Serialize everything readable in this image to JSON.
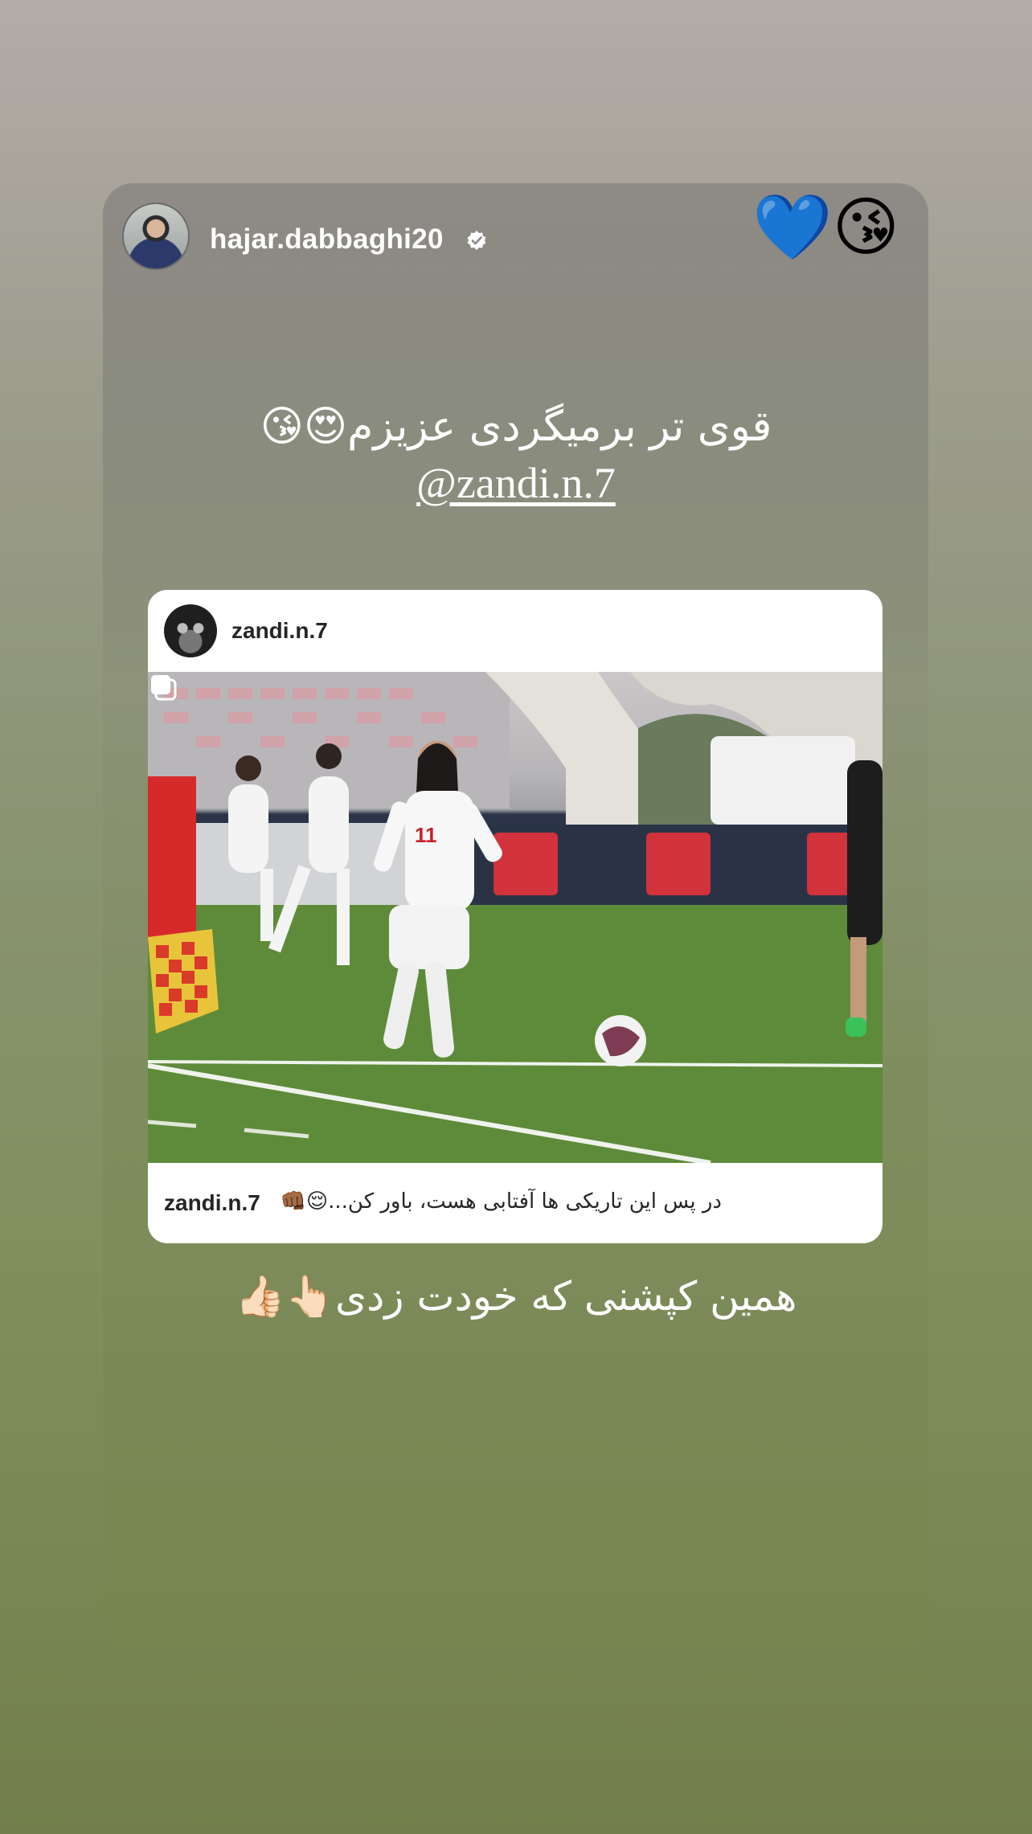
{
  "story": {
    "author_username": "hajar.dabbaghi20",
    "top_emojis": "💙😘",
    "caption_line1": "قوی تر برمیگردی عزیزم😍😘",
    "mention": "@zandi.n.7",
    "bottom_caption": "همین کپشنی که خودت زدی👆🏻👍🏻"
  },
  "shared_post": {
    "header_username": "zandi.n.7",
    "footer_username": "zandi.n.7",
    "caption": "در پس این تاریکی ها آفتابی هست، باور کن...😌👊🏾",
    "has_multiple_media": true
  },
  "icons": {
    "verified": "verified-badge-icon",
    "multi_media": "multiple-photos-icon"
  },
  "colors": {
    "text_primary": "#262626",
    "story_text": "#ffffff",
    "heart_blue": "#1a73e8"
  }
}
